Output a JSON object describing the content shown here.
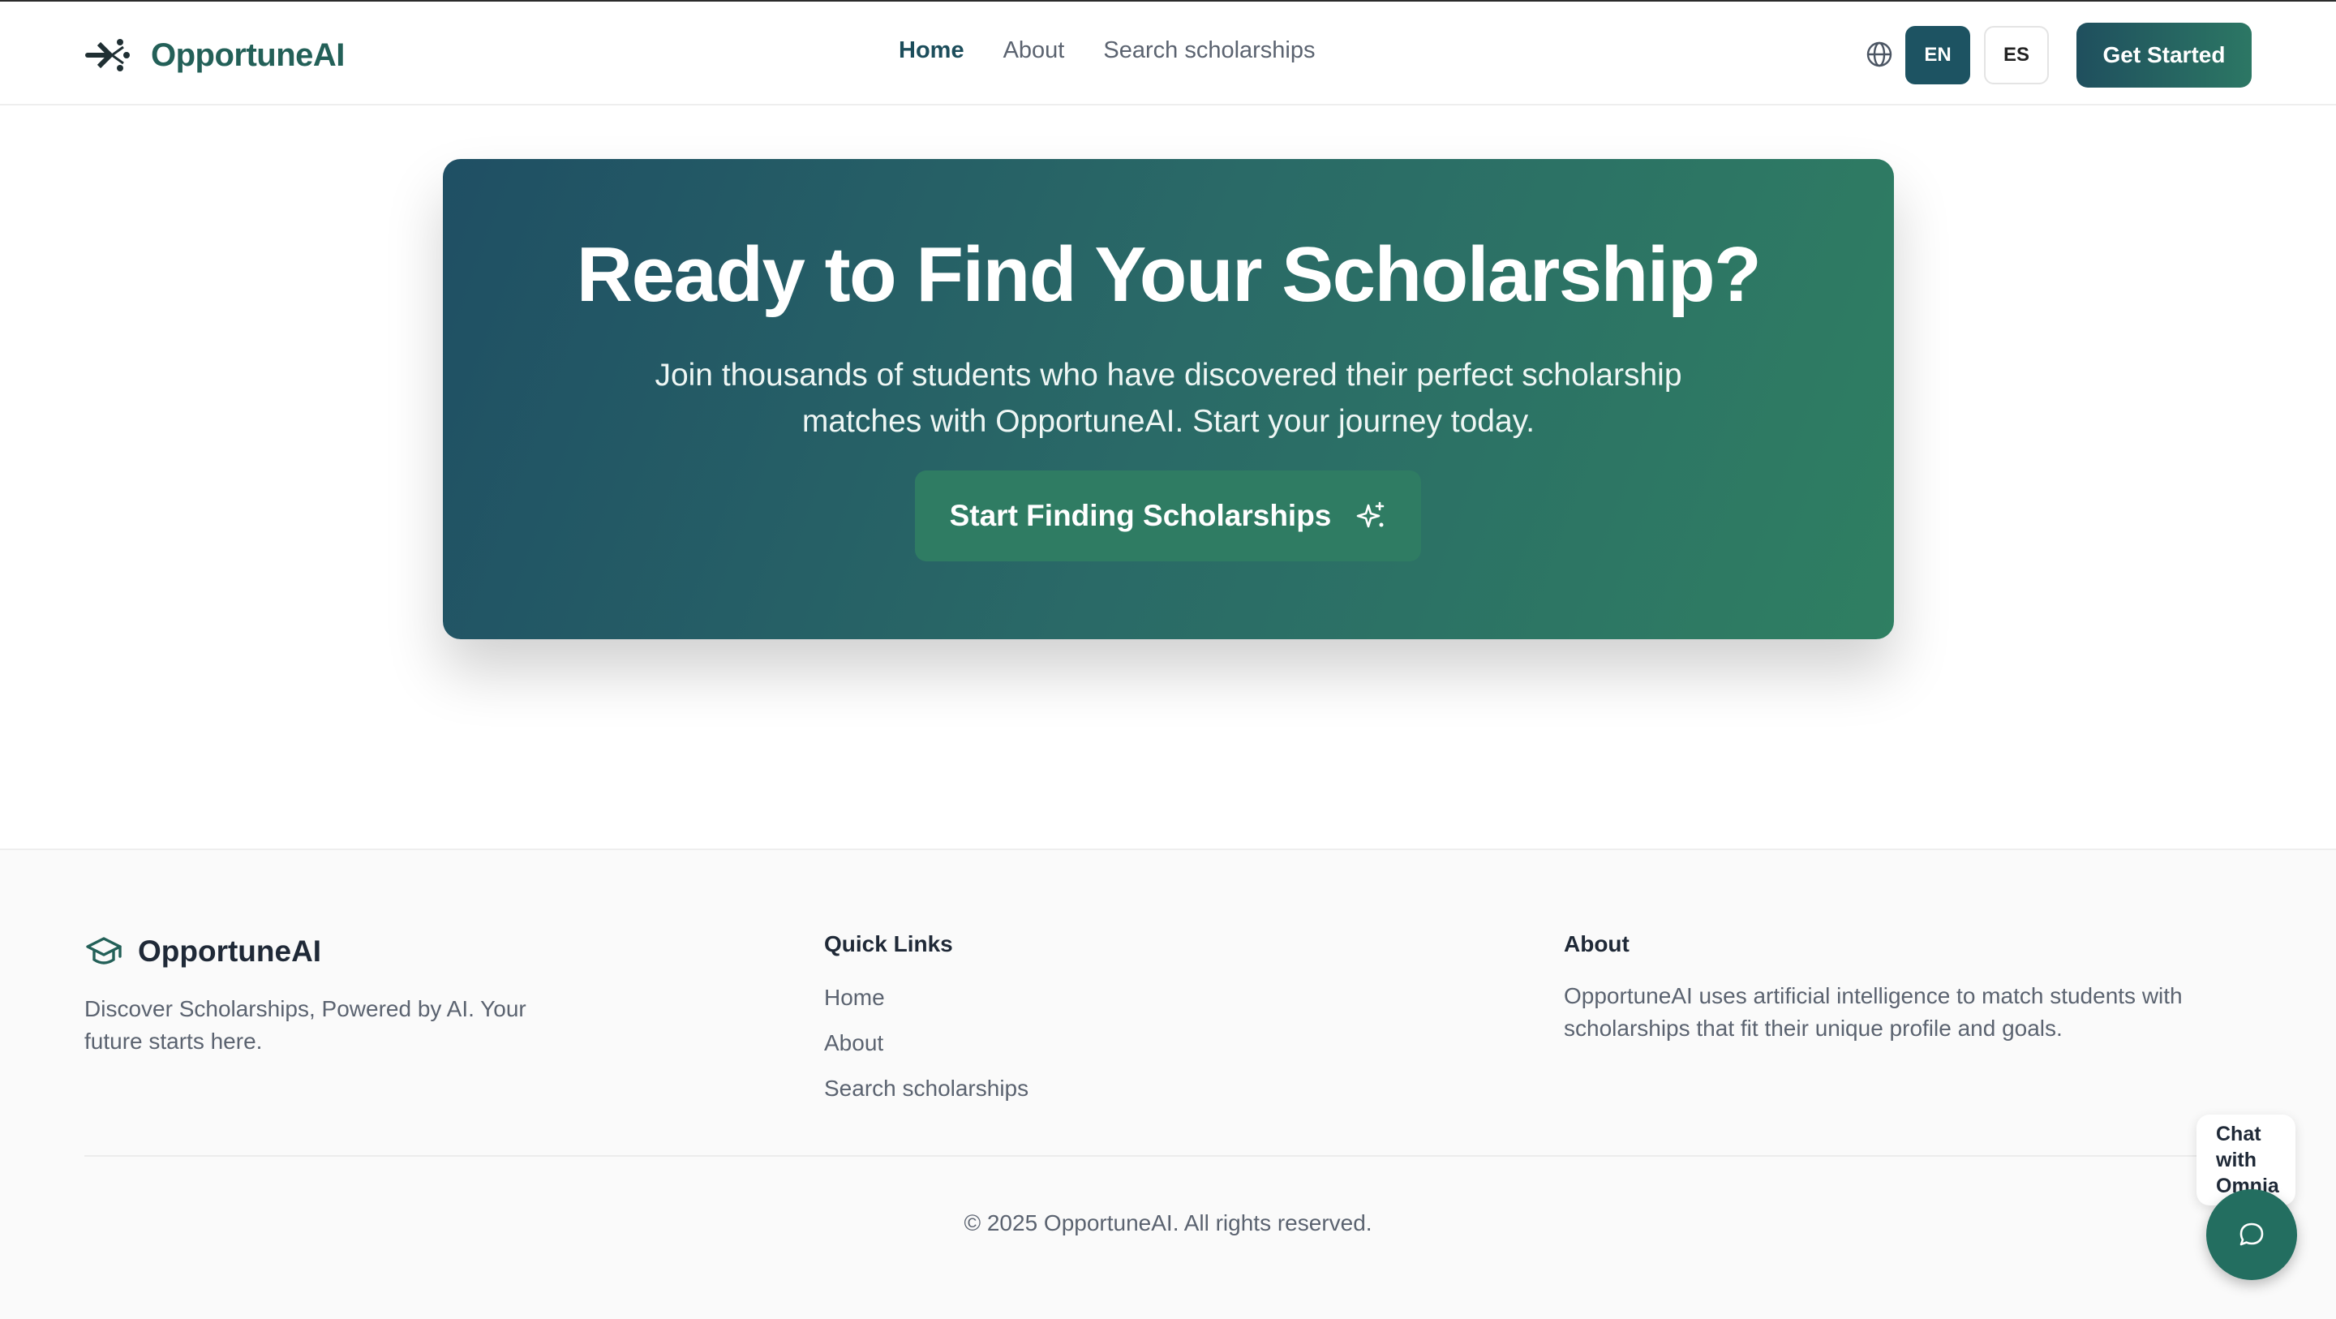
{
  "header": {
    "brand": "OpportuneAI",
    "nav": [
      "Home",
      "About",
      "Search scholarships"
    ],
    "active_nav": "Home",
    "lang_en": "EN",
    "lang_es": "ES",
    "cta": "Get Started"
  },
  "hero": {
    "title": "Ready to Find Your Scholarship?",
    "subtitle": "Join thousands of students who have discovered their perfect scholarship matches with OpportuneAI. Start your journey today.",
    "button": "Start Finding Scholarships"
  },
  "footer": {
    "brand": "OpportuneAI",
    "tagline": "Discover Scholarships, Powered by AI. Your future starts here.",
    "quick_links_title": "Quick Links",
    "quick_links": [
      "Home",
      "About",
      "Search scholarships"
    ],
    "about_title": "About",
    "about_text": "OpportuneAI uses artificial intelligence to match students with scholarships that fit their unique profile and goals.",
    "copyright": "© 2025 OpportuneAI. All rights reserved."
  },
  "chat": {
    "label": "Chat with Omnia"
  },
  "colors": {
    "brand_dark": "#1d5362",
    "brand_green": "#2f7c63",
    "text_muted": "#5b6370"
  }
}
